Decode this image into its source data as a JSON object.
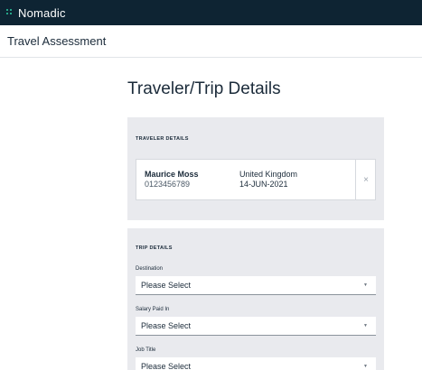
{
  "app": {
    "name": "Nomadic"
  },
  "subheader": {
    "title": "Travel Assessment"
  },
  "page": {
    "title": "Traveler/Trip Details"
  },
  "traveler_details": {
    "section_label": "TRAVELER DETAILS",
    "name": "Maurice Moss",
    "id": "0123456789",
    "country": "United Kingdom",
    "date": "14-JUN-2021",
    "remove_icon": "×"
  },
  "trip_details": {
    "section_label": "TRIP DETAILS",
    "fields": [
      {
        "label": "Destination",
        "value": "Please Select"
      },
      {
        "label": "Salary Paid In",
        "value": "Please Select"
      },
      {
        "label": "Job Title",
        "value": "Please Select"
      }
    ]
  },
  "colors": {
    "topbar": "#0e2433",
    "accent": "#2fd0a6",
    "card": "#e9eaee"
  }
}
